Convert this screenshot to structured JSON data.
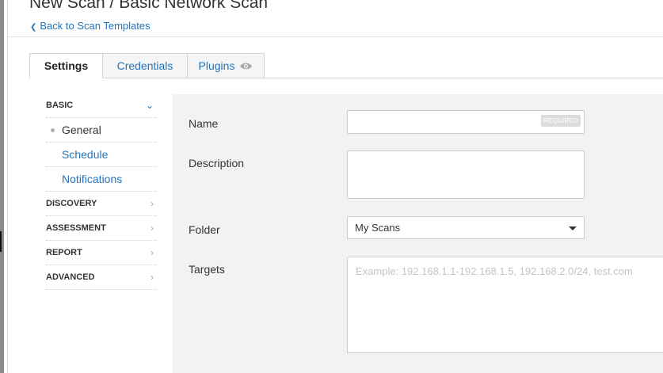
{
  "header": {
    "title": "New Scan / Basic Network Scan",
    "back_link": "Back to Scan Templates"
  },
  "tabs": [
    {
      "label": "Settings",
      "active": true
    },
    {
      "label": "Credentials",
      "active": false
    },
    {
      "label": "Plugins",
      "active": false,
      "icon": "eye-icon"
    }
  ],
  "sidebar": {
    "sections": [
      {
        "label": "BASIC",
        "expanded": true,
        "icon": "chevron-down-icon"
      },
      {
        "label": "DISCOVERY",
        "icon": "chevron-right-icon"
      },
      {
        "label": "ASSESSMENT",
        "icon": "chevron-right-icon"
      },
      {
        "label": "REPORT",
        "icon": "chevron-right-icon"
      },
      {
        "label": "ADVANCED",
        "icon": "chevron-right-icon"
      }
    ],
    "basic_items": [
      {
        "label": "General",
        "active": true
      },
      {
        "label": "Schedule"
      },
      {
        "label": "Notifications"
      }
    ]
  },
  "form": {
    "name": {
      "label": "Name",
      "value": "",
      "badge": "REQUIRED"
    },
    "description": {
      "label": "Description",
      "value": ""
    },
    "folder": {
      "label": "Folder",
      "value": "My Scans"
    },
    "targets": {
      "label": "Targets",
      "value": "",
      "placeholder": "Example: 192.168.1.1-192.168.1.5, 192.168.2.0/24, test.com"
    }
  },
  "colors": {
    "link": "#2473b8",
    "panel_bg": "#f2f2f2",
    "tab_inactive_bg": "#f5f5f5"
  }
}
